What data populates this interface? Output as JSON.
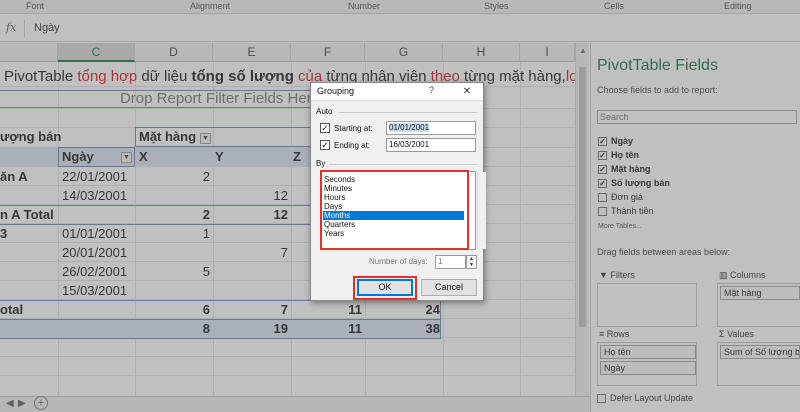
{
  "ribbon": {
    "groups": [
      "Font",
      "Alignment",
      "Number",
      "Styles",
      "Cells",
      "Editing"
    ]
  },
  "formula_bar": {
    "fx": "fx",
    "value": "Ngày"
  },
  "sheet": {
    "columns": [
      "C",
      "D",
      "E",
      "F",
      "G",
      "H",
      "I"
    ],
    "banner": {
      "p1": "PivotTable ",
      "p2": "tổng hợp",
      "p3": " dữ liệu ",
      "p4": "tổng số lượng",
      "p5": " ",
      "p6": "của",
      "p7": " từng nhân viên ",
      "p8": "theo",
      "p9": " từng mặt hàng,",
      "p10": "lọc theo"
    },
    "drop_filter": "Drop Report Filter Fields Here",
    "pivot": {
      "values_header": "ượng bán",
      "mat_hang_header": "Mặt hàng",
      "ngay_header": "Ngày",
      "col_keys": [
        "X",
        "Y",
        "Z"
      ],
      "rows": [
        {
          "label": "ăn A",
          "date": "22/01/2001",
          "x": "2",
          "y": "",
          "z": "",
          "g": ""
        },
        {
          "label": "",
          "date": "14/03/2001",
          "x": "",
          "y": "12",
          "z": "",
          "g": ""
        },
        {
          "label": "n A Total",
          "date": "",
          "x": "2",
          "y": "12",
          "z": "",
          "g": ""
        },
        {
          "label": "3",
          "date": "01/01/2001",
          "x": "1",
          "y": "",
          "z": "",
          "g": ""
        },
        {
          "label": "",
          "date": "20/01/2001",
          "x": "",
          "y": "7",
          "z": "",
          "g": ""
        },
        {
          "label": "",
          "date": "26/02/2001",
          "x": "5",
          "y": "",
          "z": "",
          "g": ""
        },
        {
          "label": "",
          "date": "15/03/2001",
          "x": "",
          "y": "",
          "z": "",
          "g": ""
        },
        {
          "label": "otal",
          "date": "",
          "x": "6",
          "y": "7",
          "z": "11",
          "g": "24"
        },
        {
          "label": "",
          "date": "",
          "x": "8",
          "y": "19",
          "z": "11",
          "g": "38"
        }
      ]
    },
    "add_sheet": "+"
  },
  "dialog": {
    "title": "Grouping",
    "help": "?",
    "close": "✕",
    "auto_label": "Auto",
    "starting_label": "Starting at:",
    "starting_value": "01/01/2001",
    "starting_checked": true,
    "ending_label": "Ending at:",
    "ending_value": "16/03/2001",
    "ending_checked": true,
    "by_label": "By",
    "by_items": [
      "Seconds",
      "Minutes",
      "Hours",
      "Days",
      "Months",
      "Quarters",
      "Years"
    ],
    "by_selected": "Months",
    "days_label": "Number of days:",
    "days_value": "1",
    "ok": "OK",
    "cancel": "Cancel"
  },
  "panel": {
    "title": "PivotTable Fields",
    "subtitle": "Choose fields to add to report:",
    "search_placeholder": "Search",
    "fields": [
      {
        "label": "Ngày",
        "checked": true
      },
      {
        "label": "Họ tên",
        "checked": true
      },
      {
        "label": "Mặt hàng",
        "checked": true
      },
      {
        "label": "Số lượng bán",
        "checked": true
      },
      {
        "label": "Đơn giá",
        "checked": false
      },
      {
        "label": "Thành tiền",
        "checked": false
      }
    ],
    "more_tables": "More Tables...",
    "drag_label": "Drag fields between areas below:",
    "filters_label": "Filters",
    "columns_label": "Columns",
    "columns_items": [
      "Mặt hàng"
    ],
    "rows_label": "Rows",
    "rows_items": [
      "Họ tên",
      "Ngày"
    ],
    "values_label": "Values",
    "values_items": [
      "Sum of Số lượng bán"
    ],
    "defer_label": "Defer Layout Update"
  },
  "colors": {
    "accent_green": "#217346",
    "highlight_red": "#e02020",
    "selection_blue": "#0078d7",
    "pivot_header_fill": "#dce6f1"
  }
}
